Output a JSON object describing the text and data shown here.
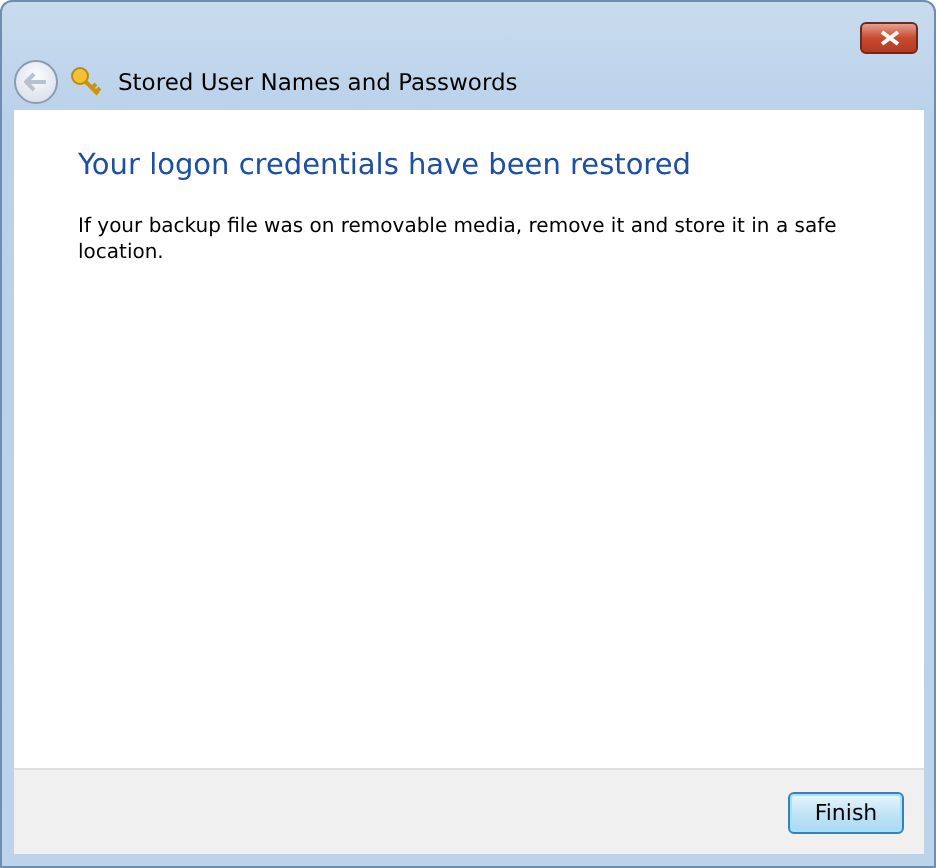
{
  "window": {
    "title": "Stored User Names and Passwords"
  },
  "heading": "Your logon credentials have been restored",
  "message": "If your backup file was on removable media, remove it and store it in a safe location.",
  "buttons": [
    {
      "label": "Finish"
    }
  ]
}
